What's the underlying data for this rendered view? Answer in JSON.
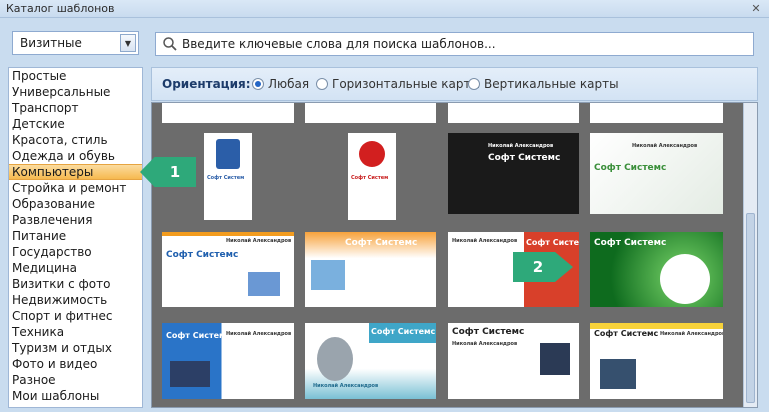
{
  "window": {
    "title": "Каталог шаблонов",
    "close": "✕"
  },
  "type_select": {
    "value": "Визитные",
    "arrow": "▼"
  },
  "categories": [
    "Простые",
    "Универсальные",
    "Транспорт",
    "Детские",
    "Красота, стиль",
    "Одежда и обувь",
    "Компьютеры",
    "Стройка и ремонт",
    "Образование",
    "Развлечения",
    "Питание",
    "Государство",
    "Медицина",
    "Визитки с фото",
    "Недвижимость",
    "Спорт и фитнес",
    "Техника",
    "Туризм и отдых",
    "Фото и видео",
    "Разное",
    "Мои шаблоны"
  ],
  "selected_category": "Компьютеры",
  "search": {
    "placeholder": "Введите ключевые слова для поиска шаблонов..."
  },
  "orientation": {
    "label": "Ориентация:",
    "options": [
      "Любая",
      "Горизонтальные карты",
      "Вертикальные карты"
    ],
    "selected": "Любая"
  },
  "cards": {
    "brand": "Софт Системс",
    "person": "Николай Александров",
    "role": "Менеджер по продажам",
    "vbrand": "Софт Систем"
  },
  "callouts": {
    "one": "1",
    "two": "2"
  },
  "colors": {
    "selected_item": "#f6b94f",
    "callout": "#2ea97a",
    "accent": "#1c3b6a"
  }
}
